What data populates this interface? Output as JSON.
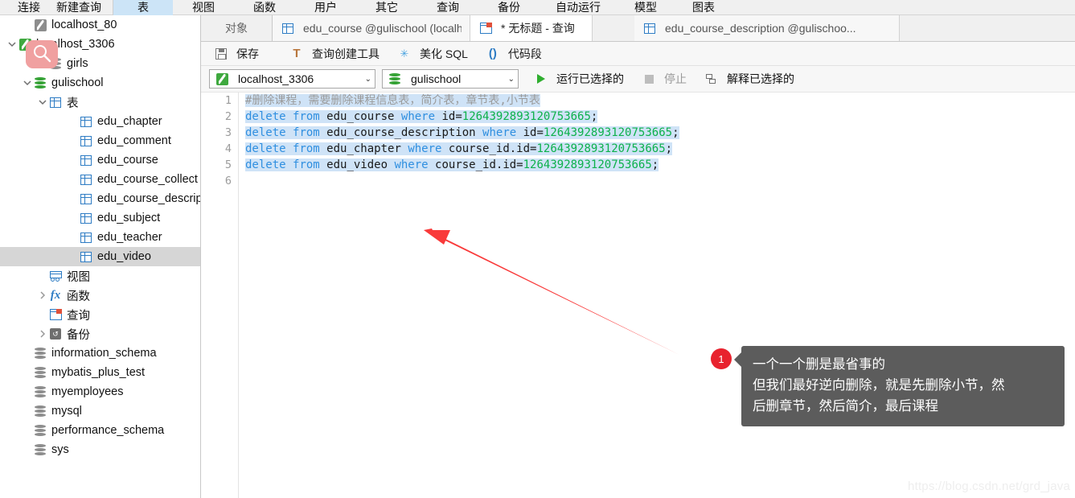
{
  "main_toolbar": {
    "items": [
      {
        "label": "连接",
        "icon": "connection-icon",
        "active": false
      },
      {
        "label": "新建查询",
        "icon": "new-query-icon",
        "active": false
      },
      {
        "label": "表",
        "icon": "table-icon",
        "active": true
      },
      {
        "label": "视图",
        "icon": "view-icon",
        "active": false
      },
      {
        "label": "函数",
        "icon": "function-icon",
        "active": false
      },
      {
        "label": "用户",
        "icon": "user-icon",
        "active": false
      },
      {
        "label": "其它",
        "icon": "other-icon",
        "active": false
      },
      {
        "label": "查询",
        "icon": "query-icon",
        "active": false
      },
      {
        "label": "备份",
        "icon": "backup-icon",
        "active": false
      },
      {
        "label": "自动运行",
        "icon": "automation-icon",
        "active": false
      },
      {
        "label": "模型",
        "icon": "model-icon",
        "active": false
      },
      {
        "label": "图表",
        "icon": "chart-icon",
        "active": false
      }
    ]
  },
  "sidebar": {
    "items": [
      {
        "label": "localhost_80",
        "icon": "connection-icon-gray",
        "indent": 1,
        "twisty": "",
        "selected": false
      },
      {
        "label": "localhost_3306",
        "icon": "connection-icon",
        "indent": 0,
        "twisty": "expanded",
        "selected": false
      },
      {
        "label": "girls",
        "icon": "database-icon-gray",
        "indent": 2,
        "twisty": "",
        "selected": false
      },
      {
        "label": "gulischool",
        "icon": "database-icon",
        "indent": 1,
        "twisty": "expanded",
        "selected": false
      },
      {
        "label": "表",
        "icon": "table-icon",
        "indent": 2,
        "twisty": "expanded",
        "selected": false
      },
      {
        "label": "edu_chapter",
        "icon": "table-icon",
        "indent": 4,
        "twisty": "",
        "selected": false
      },
      {
        "label": "edu_comment",
        "icon": "table-icon",
        "indent": 4,
        "twisty": "",
        "selected": false
      },
      {
        "label": "edu_course",
        "icon": "table-icon",
        "indent": 4,
        "twisty": "",
        "selected": false
      },
      {
        "label": "edu_course_collect",
        "icon": "table-icon",
        "indent": 4,
        "twisty": "",
        "selected": false
      },
      {
        "label": "edu_course_descripti",
        "icon": "table-icon",
        "indent": 4,
        "twisty": "",
        "selected": false
      },
      {
        "label": "edu_subject",
        "icon": "table-icon",
        "indent": 4,
        "twisty": "",
        "selected": false
      },
      {
        "label": "edu_teacher",
        "icon": "table-icon",
        "indent": 4,
        "twisty": "",
        "selected": false
      },
      {
        "label": "edu_video",
        "icon": "table-icon",
        "indent": 4,
        "twisty": "",
        "selected": true
      },
      {
        "label": "视图",
        "icon": "view-icon",
        "indent": 2,
        "twisty": "",
        "selected": false
      },
      {
        "label": "函数",
        "icon": "function-icon",
        "indent": 2,
        "twisty": "collapsed",
        "selected": false
      },
      {
        "label": "查询",
        "icon": "query-icon",
        "indent": 2,
        "twisty": "",
        "selected": false
      },
      {
        "label": "备份",
        "icon": "backup-icon",
        "indent": 2,
        "twisty": "collapsed",
        "selected": false
      },
      {
        "label": "information_schema",
        "icon": "database-icon-gray",
        "indent": 1,
        "twisty": "",
        "selected": false
      },
      {
        "label": "mybatis_plus_test",
        "icon": "database-icon-gray",
        "indent": 1,
        "twisty": "",
        "selected": false
      },
      {
        "label": "myemployees",
        "icon": "database-icon-gray",
        "indent": 1,
        "twisty": "",
        "selected": false
      },
      {
        "label": "mysql",
        "icon": "database-icon-gray",
        "indent": 1,
        "twisty": "",
        "selected": false
      },
      {
        "label": "performance_schema",
        "icon": "database-icon-gray",
        "indent": 1,
        "twisty": "",
        "selected": false
      },
      {
        "label": "sys",
        "icon": "database-icon-gray",
        "indent": 1,
        "twisty": "",
        "selected": false
      }
    ]
  },
  "tabstrip": {
    "object_tab": "对象",
    "tabs": [
      {
        "label": "edu_course @gulischool (localhost_...",
        "icon": "table-icon",
        "active": false
      },
      {
        "label": "* 无标题 - 查询",
        "icon": "query-icon",
        "active": true
      },
      {
        "label": "edu_course_description @gulischoo...",
        "icon": "table-icon",
        "active": false
      }
    ]
  },
  "query_toolbar": {
    "buttons": [
      {
        "label": "保存",
        "icon": "save-icon"
      },
      {
        "label": "查询创建工具",
        "icon": "query-builder-icon"
      },
      {
        "label": "美化 SQL",
        "icon": "beautify-icon"
      },
      {
        "label": "代码段",
        "icon": "code-snippet-icon"
      }
    ]
  },
  "connection_bar": {
    "connection_value": "localhost_3306",
    "database_value": "gulischool",
    "run_selected_label": "运行已选择的",
    "stop_label": "停止",
    "explain_selected_label": "解释已选择的"
  },
  "editor": {
    "line_numbers": [
      "1",
      "2",
      "3",
      "4",
      "5",
      "6"
    ],
    "lines": [
      {
        "n": 1,
        "selected": true,
        "tokens": [
          {
            "t": "#删除课程，需要删除课程信息表，简介表，章节表,小节表",
            "c": "cmt"
          }
        ]
      },
      {
        "n": 2,
        "selected": true,
        "tokens": [
          {
            "t": "delete",
            "c": "kw"
          },
          {
            "t": " ",
            "c": "pl"
          },
          {
            "t": "from",
            "c": "kw"
          },
          {
            "t": " edu_course ",
            "c": "pl"
          },
          {
            "t": "where",
            "c": "kw"
          },
          {
            "t": " id=",
            "c": "pl"
          },
          {
            "t": "1264392893120753665",
            "c": "num"
          },
          {
            "t": ";",
            "c": "pl"
          }
        ]
      },
      {
        "n": 3,
        "selected": true,
        "tokens": [
          {
            "t": "delete",
            "c": "kw"
          },
          {
            "t": " ",
            "c": "pl"
          },
          {
            "t": "from",
            "c": "kw"
          },
          {
            "t": " edu_course_description ",
            "c": "pl"
          },
          {
            "t": "where",
            "c": "kw"
          },
          {
            "t": " id=",
            "c": "pl"
          },
          {
            "t": "1264392893120753665",
            "c": "num"
          },
          {
            "t": ";",
            "c": "pl"
          }
        ]
      },
      {
        "n": 4,
        "selected": true,
        "tokens": [
          {
            "t": "delete",
            "c": "kw"
          },
          {
            "t": " ",
            "c": "pl"
          },
          {
            "t": "from",
            "c": "kw"
          },
          {
            "t": " edu_chapter ",
            "c": "pl"
          },
          {
            "t": "where",
            "c": "kw"
          },
          {
            "t": " course_id.id=",
            "c": "pl"
          },
          {
            "t": "1264392893120753665",
            "c": "num"
          },
          {
            "t": ";",
            "c": "pl"
          }
        ]
      },
      {
        "n": 5,
        "selected": true,
        "tokens": [
          {
            "t": "delete",
            "c": "kw"
          },
          {
            "t": " ",
            "c": "pl"
          },
          {
            "t": "from",
            "c": "kw"
          },
          {
            "t": " edu_video ",
            "c": "pl"
          },
          {
            "t": "where",
            "c": "kw"
          },
          {
            "t": " course_id.id=",
            "c": "pl"
          },
          {
            "t": "1264392893120753665",
            "c": "num"
          },
          {
            "t": ";",
            "c": "pl"
          }
        ]
      },
      {
        "n": 6,
        "selected": false,
        "tokens": []
      }
    ]
  },
  "annotation": {
    "number": "1",
    "lines": [
      "一个一个删是最省事的",
      "但我们最好逆向删除，就是先删除小节，然",
      "后删章节，然后简介，最后课程"
    ],
    "arrow_color": "#f93a3a",
    "badge_color": "#e8222e",
    "box_color": "#5c5c5c"
  },
  "watermark": "https://blog.csdn.net/grd_java",
  "colors": {
    "keyword": "#2f8fe0",
    "number": "#0db14b",
    "comment": "#9a9a9a",
    "selection": "#cfe3f7",
    "accent_green": "#35a235",
    "highlight_pink": "#f0a0a0"
  }
}
